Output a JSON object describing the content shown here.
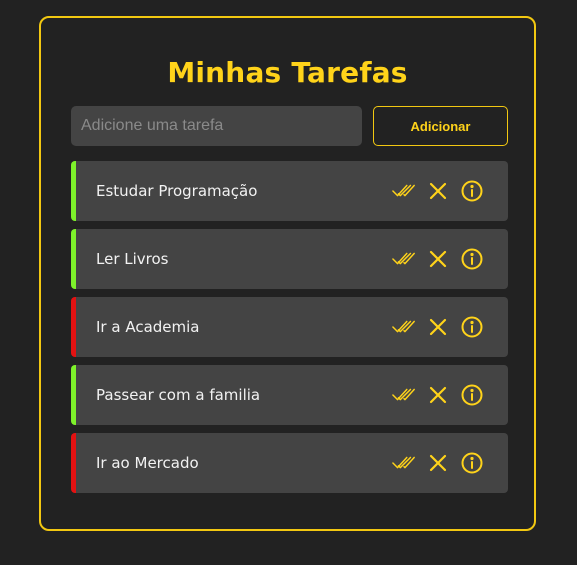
{
  "app": {
    "title": "Minhas Tarefas"
  },
  "form": {
    "placeholder": "Adicione uma tarefa",
    "value": "",
    "add_label": "Adicionar"
  },
  "colors": {
    "accent": "#ffd31a",
    "done": "#7ef22b",
    "pending": "#e31212",
    "background": "#222222",
    "item_background": "#444444"
  },
  "tasks": [
    {
      "label": "Estudar Programação",
      "status": "done"
    },
    {
      "label": "Ler Livros",
      "status": "done"
    },
    {
      "label": "Ir a Academia",
      "status": "pending"
    },
    {
      "label": "Passear com a familia",
      "status": "done"
    },
    {
      "label": "Ir ao Mercado",
      "status": "pending"
    }
  ],
  "task_actions": [
    {
      "name": "complete-icon"
    },
    {
      "name": "close-icon"
    },
    {
      "name": "info-icon"
    }
  ]
}
